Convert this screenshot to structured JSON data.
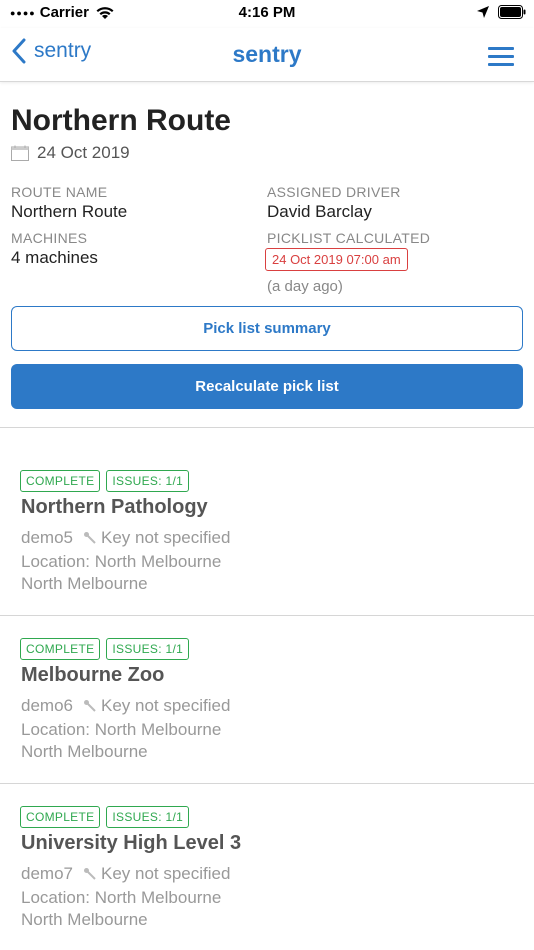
{
  "status_bar": {
    "carrier": "Carrier",
    "time": "4:16 PM",
    "icons": [
      "signal-dots-icon",
      "wifi-icon",
      "location-arrow-icon",
      "battery-icon"
    ]
  },
  "nav": {
    "back_label": "sentry",
    "title": "sentry",
    "menu_icon": "hamburger-menu-icon",
    "accent_color": "#2d79c7"
  },
  "route": {
    "title": "Northern Route",
    "date": "24 Oct 2019",
    "date_icon": "calendar-icon",
    "fields": {
      "route_name_label": "ROUTE NAME",
      "route_name_value": "Northern Route",
      "machines_label": "MACHINES",
      "machines_value": "4 machines",
      "driver_label": "ASSIGNED DRIVER",
      "driver_value": "David Barclay",
      "picklist_label": "PICKLIST CALCULATED",
      "picklist_value": "24 Oct 2019 07:00 am",
      "picklist_ago": "(a day ago)"
    },
    "buttons": {
      "summary": "Pick list summary",
      "recalculate": "Recalculate pick list"
    }
  },
  "machines": [
    {
      "status": "COMPLETE",
      "issues": "ISSUES: 1/1",
      "name": "Northern Pathology",
      "code": "demo5",
      "key": "Key not specified",
      "location": "Location: North Melbourne",
      "suburb": "North Melbourne"
    },
    {
      "status": "COMPLETE",
      "issues": "ISSUES: 1/1",
      "name": "Melbourne Zoo",
      "code": "demo6",
      "key": "Key not specified",
      "location": "Location: North Melbourne",
      "suburb": "North Melbourne"
    },
    {
      "status": "COMPLETE",
      "issues": "ISSUES: 1/1",
      "name": "University High Level 3",
      "code": "demo7",
      "key": "Key not specified",
      "location": "Location: North Melbourne",
      "suburb": "North Melbourne"
    }
  ],
  "colors": {
    "complete_badge": "#2fa84f",
    "picklist_tag": "#d94040"
  }
}
